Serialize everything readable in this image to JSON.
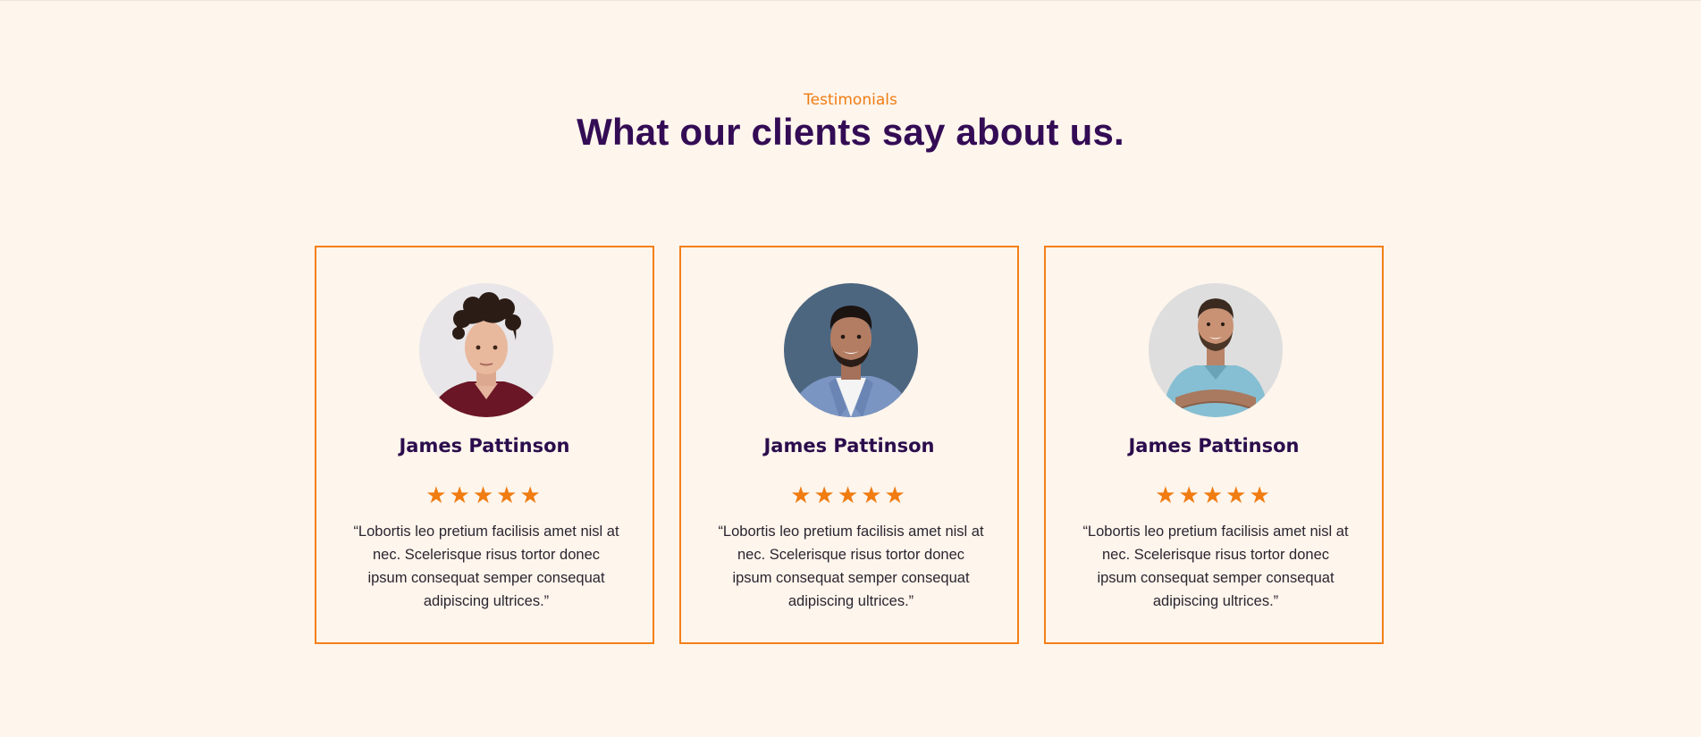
{
  "section": {
    "eyebrow": "Testimonials",
    "headline": "What our clients say about us."
  },
  "testimonials": [
    {
      "name": "James Pattinson",
      "rating": 5,
      "rating_stars": "★★★★★",
      "quote": "“Lobortis leo pretium facilisis amet nisl at nec. Scelerisque risus tortor donec ipsum consequat semper consequat adipiscing ultrices.”"
    },
    {
      "name": "James Pattinson",
      "rating": 5,
      "rating_stars": "★★★★★",
      "quote": "“Lobortis leo pretium facilisis amet nisl at nec. Scelerisque risus tortor donec ipsum consequat semper consequat adipiscing ultrices.”"
    },
    {
      "name": "James Pattinson",
      "rating": 5,
      "rating_stars": "★★★★★",
      "quote": "“Lobortis leo pretium facilisis amet nisl at nec. Scelerisque risus tortor donec ipsum consequat semper consequat adipiscing ultrices.”"
    }
  ],
  "colors": {
    "background": "#fef5ec",
    "accent": "#f07c12",
    "heading": "#330c55"
  }
}
